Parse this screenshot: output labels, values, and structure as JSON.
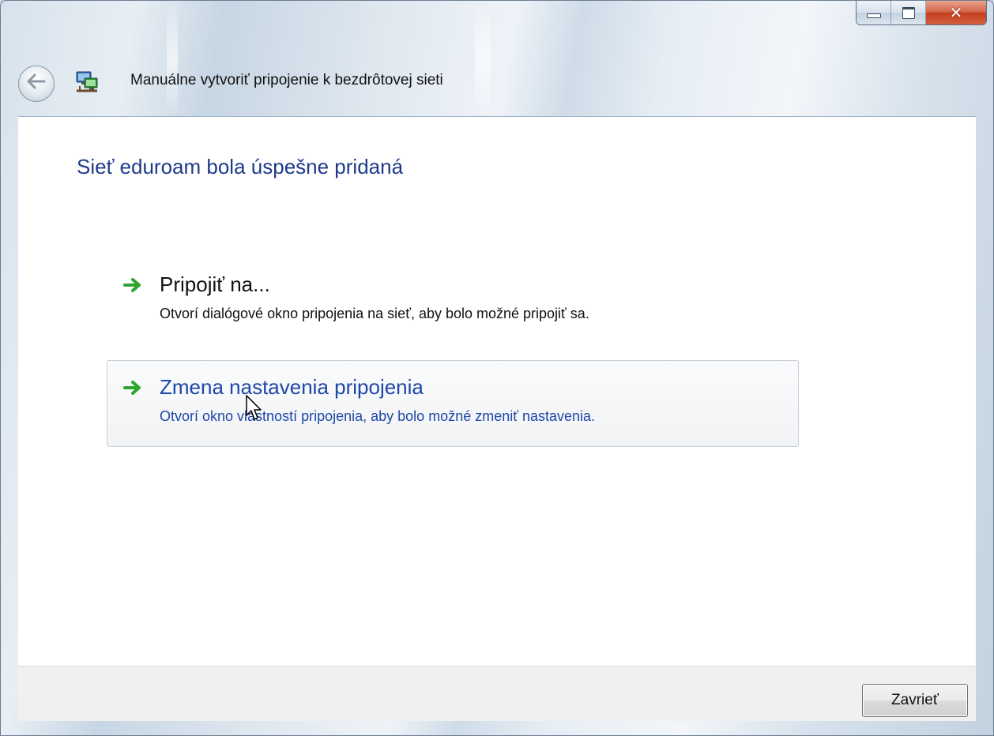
{
  "window": {
    "title": "Manuálne vytvoriť pripojenie k bezdrôtovej sieti",
    "caption_buttons": {
      "minimize_icon": "minimize-icon",
      "maximize_icon": "maximize-icon",
      "close_glyph": "✕"
    },
    "back_icon": "back-arrow-icon",
    "app_icon": "network-icon"
  },
  "content": {
    "heading": "Sieť eduroam bola úspešne pridaná",
    "options": [
      {
        "title": "Pripojiť na...",
        "description": "Otvorí dialógové okno pripojenia na sieť, aby bolo možné pripojiť sa.",
        "icon": "green-arrow-icon",
        "hover": false
      },
      {
        "title": "Zmena nastavenia pripojenia",
        "description": "Otvorí okno vlastností pripojenia, aby bolo možné zmeniť nastavenia.",
        "icon": "green-arrow-icon",
        "hover": true
      }
    ]
  },
  "footer": {
    "close_label": "Zavrieť"
  },
  "colors": {
    "heading": "#1e3a8a",
    "hover_link": "#1f47a8",
    "arrow_green": "#2fa52f"
  }
}
